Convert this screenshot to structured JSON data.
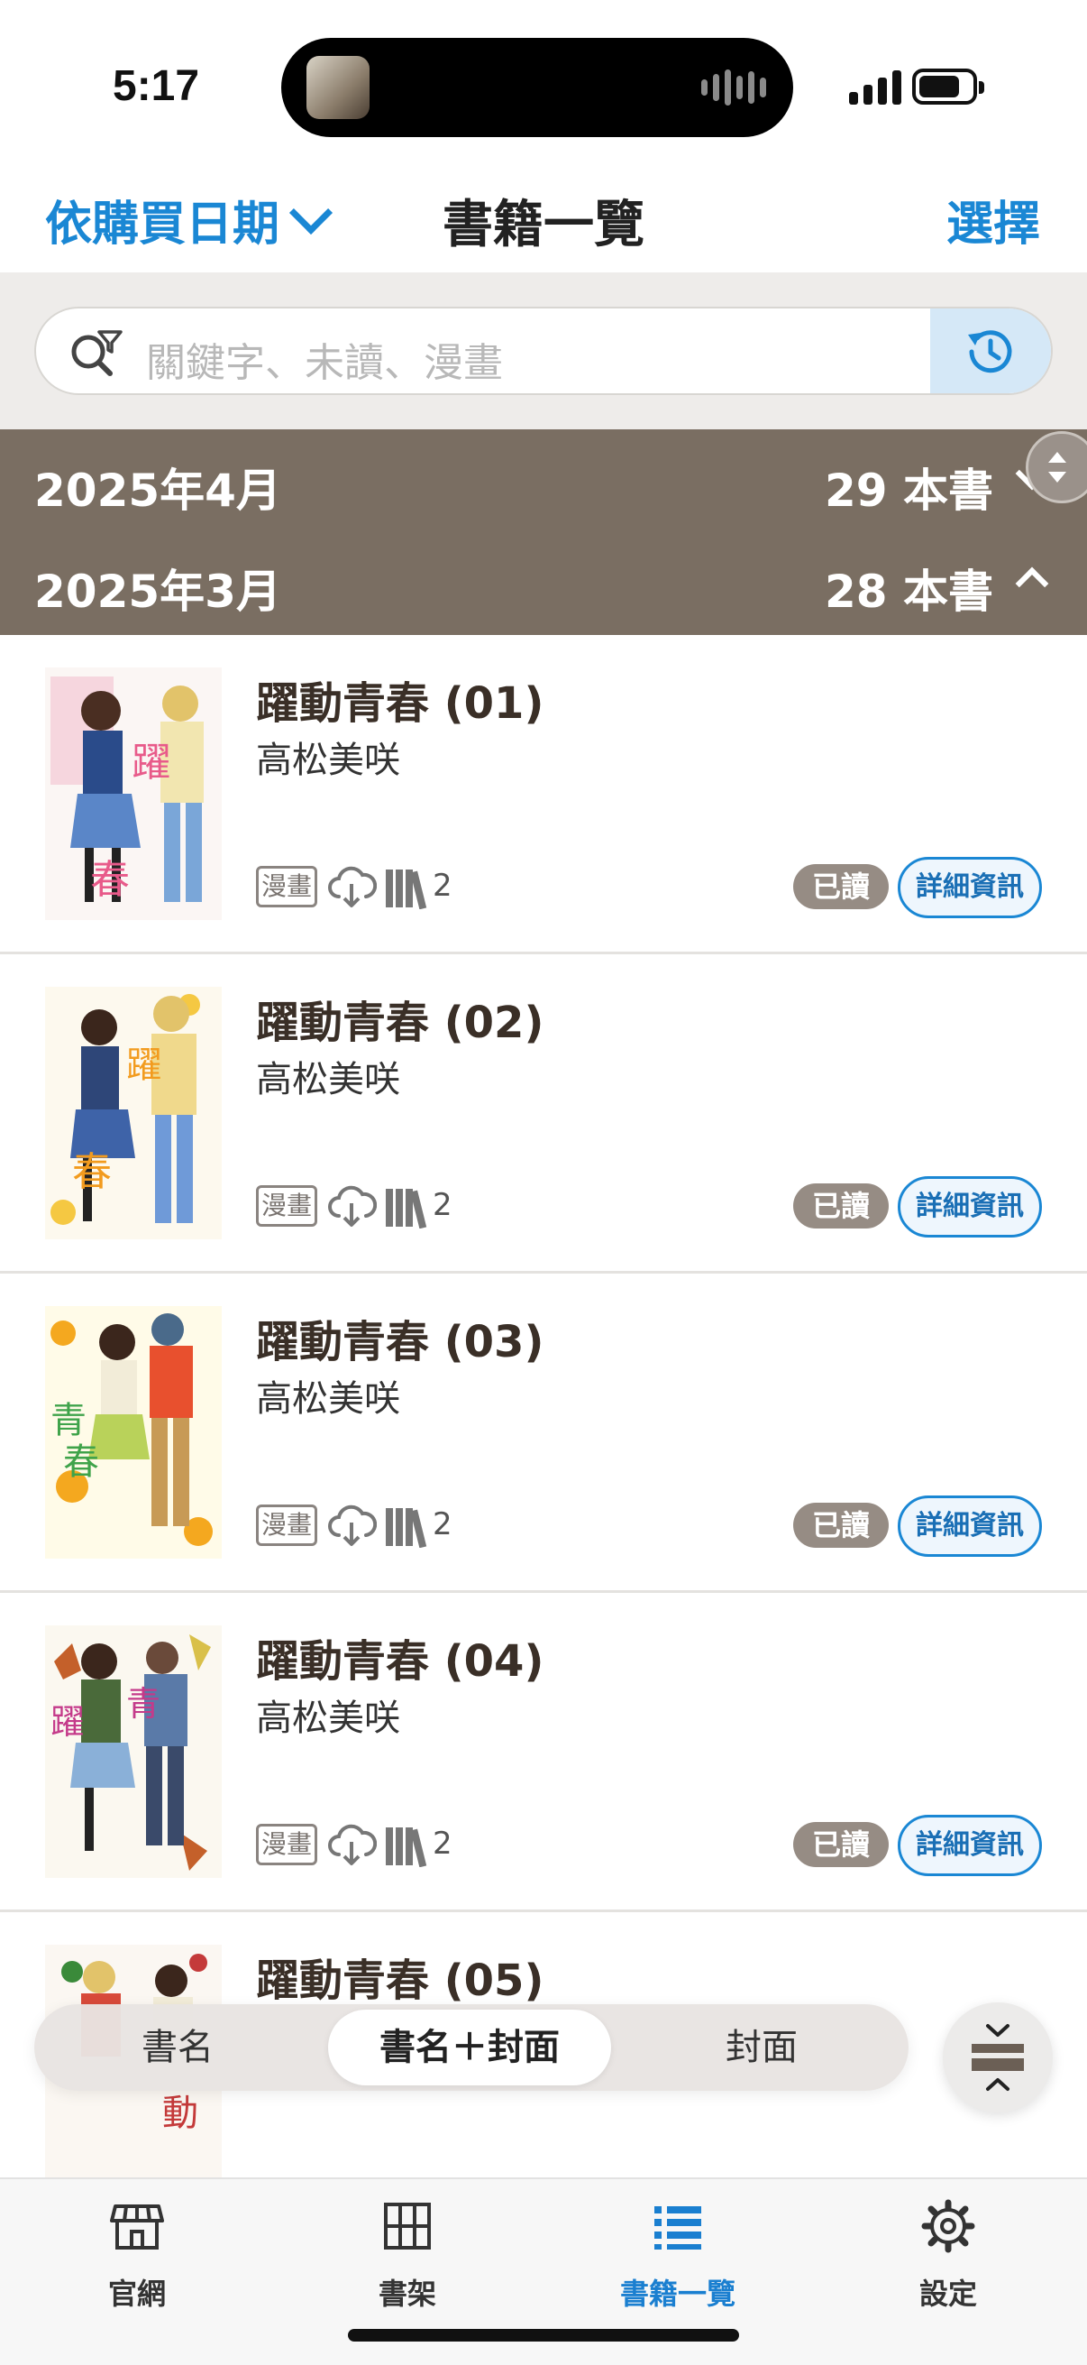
{
  "status_bar": {
    "time": "5:17"
  },
  "nav": {
    "sort_label": "依購買日期",
    "title": "書籍一覽",
    "select_label": "選擇"
  },
  "search": {
    "placeholder": "關鍵字、未讀、漫畫"
  },
  "months": [
    {
      "label": "2025年4月",
      "count": "29 本書",
      "expanded": false
    },
    {
      "label": "2025年3月",
      "count": "28 本書",
      "expanded": true
    }
  ],
  "books": [
    {
      "title": "躍動青春 (01)",
      "author": "高松美咲",
      "tag": "漫畫",
      "shelf_count": "2",
      "status": "已讀",
      "detail_label": "詳細資訊"
    },
    {
      "title": "躍動青春 (02)",
      "author": "高松美咲",
      "tag": "漫畫",
      "shelf_count": "2",
      "status": "已讀",
      "detail_label": "詳細資訊"
    },
    {
      "title": "躍動青春 (03)",
      "author": "高松美咲",
      "tag": "漫畫",
      "shelf_count": "2",
      "status": "已讀",
      "detail_label": "詳細資訊"
    },
    {
      "title": "躍動青春 (04)",
      "author": "高松美咲",
      "tag": "漫畫",
      "shelf_count": "2",
      "status": "已讀",
      "detail_label": "詳細資訊"
    },
    {
      "title": "躍動青春 (05)"
    }
  ],
  "view_toggle": {
    "options": [
      "書名",
      "書名＋封面",
      "封面"
    ],
    "active": "書名＋封面"
  },
  "tabs": [
    {
      "label": "官網",
      "icon": "store-icon"
    },
    {
      "label": "書架",
      "icon": "grid-icon"
    },
    {
      "label": "書籍一覽",
      "icon": "list-icon",
      "active": true
    },
    {
      "label": "設定",
      "icon": "gear-icon"
    }
  ],
  "colors": {
    "accent": "#1a87d4",
    "month_bar": "#7a6e62",
    "read_badge": "#968c84"
  }
}
